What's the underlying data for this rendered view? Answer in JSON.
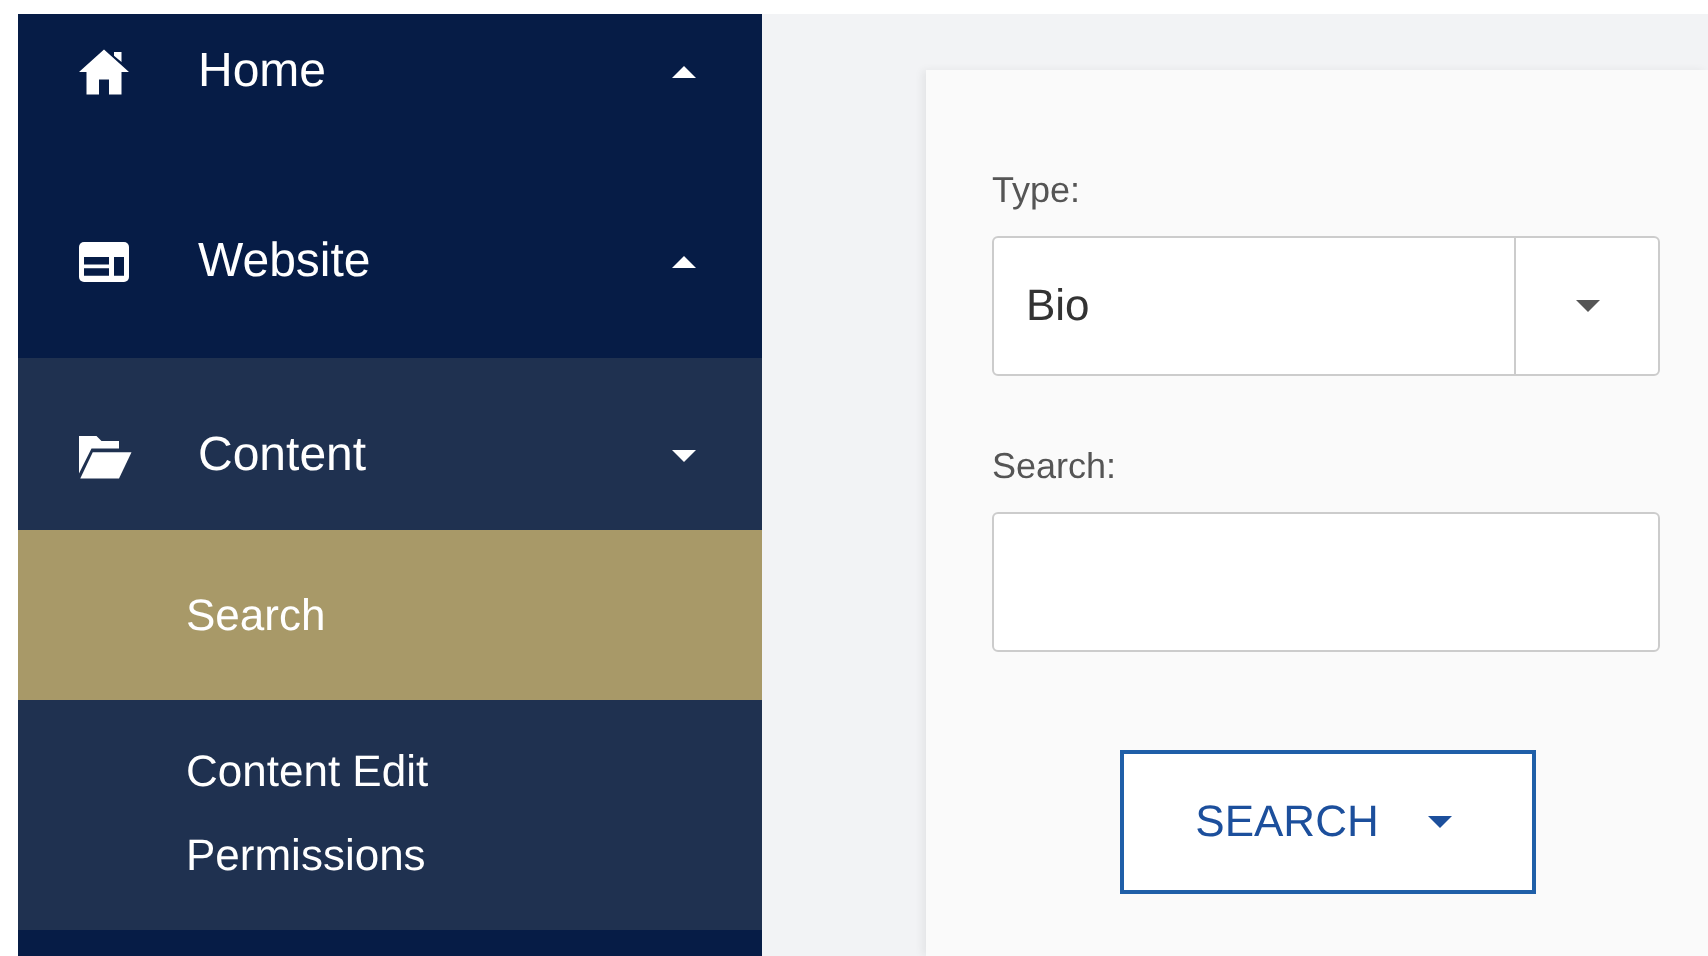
{
  "sidebar": {
    "items": [
      {
        "label": "Home",
        "expanded": false
      },
      {
        "label": "Website",
        "expanded": false
      },
      {
        "label": "Content",
        "expanded": true,
        "children": [
          {
            "label": "Search",
            "selected": true
          },
          {
            "label": "Content Edit Permissions",
            "selected": false
          }
        ]
      }
    ]
  },
  "form": {
    "fields": [
      {
        "kind": "select",
        "label": "Type:",
        "value": "Bio"
      },
      {
        "kind": "text",
        "label": "Search:"
      }
    ],
    "button": {
      "label": "SEARCH"
    }
  }
}
